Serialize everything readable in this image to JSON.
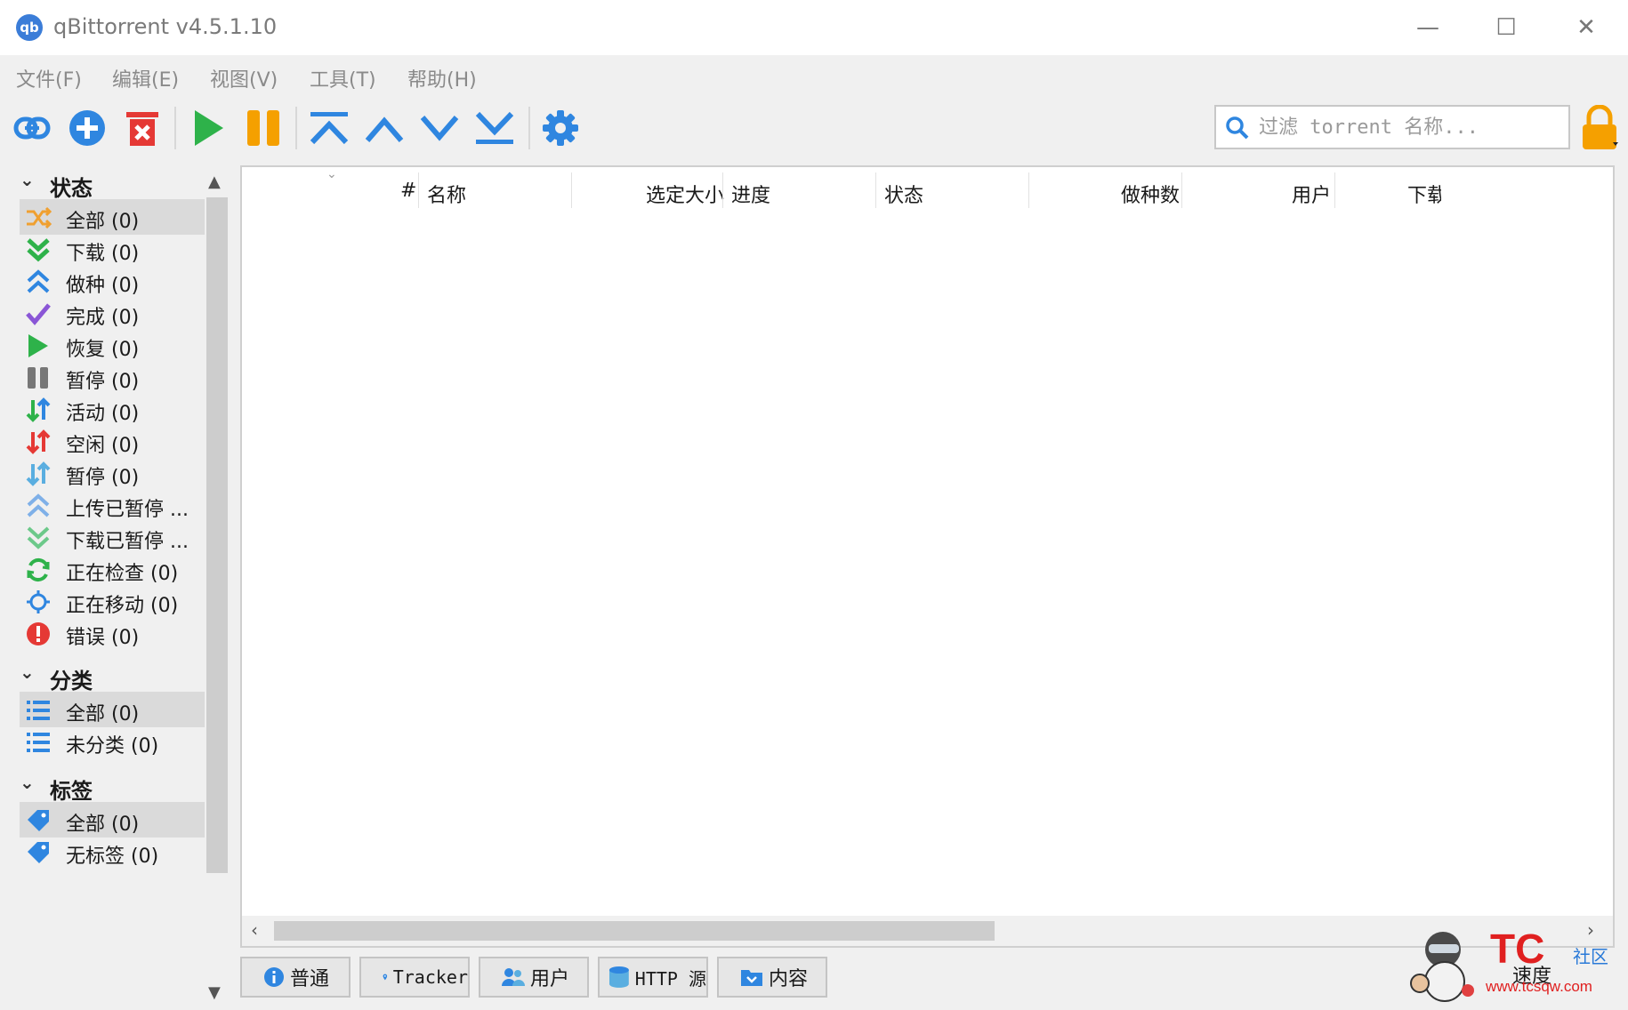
{
  "window": {
    "title": "qBittorrent v4.5.1.10",
    "app_icon_text": "qb",
    "min_symbol": "—",
    "max_symbol": "☐",
    "close_symbol": "✕"
  },
  "menu": {
    "items": [
      "文件(F)",
      "编辑(E)",
      "视图(V)",
      "工具(T)",
      "帮助(H)"
    ]
  },
  "toolbar": {
    "icons": [
      "add-link-icon",
      "add-torrent-icon",
      "delete-icon",
      "resume-icon",
      "pause-icon",
      "move-top-icon",
      "move-up-icon",
      "move-down-icon",
      "move-bottom-icon",
      "settings-icon"
    ],
    "search_placeholder": "过滤 torrent 名称...",
    "accent_blue": "#2f86e0",
    "accent_red": "#e53935",
    "accent_green": "#2eb24a",
    "accent_orange": "#f5a000"
  },
  "sidebar": {
    "status": {
      "title": "状态",
      "items": [
        {
          "label": "全部 (0)",
          "icon": "shuffle-icon",
          "selected": true
        },
        {
          "label": "下载 (0)",
          "icon": "download-icon"
        },
        {
          "label": "做种 (0)",
          "icon": "seeding-icon"
        },
        {
          "label": "完成 (0)",
          "icon": "check-icon"
        },
        {
          "label": "恢复 (0)",
          "icon": "resume-icon"
        },
        {
          "label": "暂停 (0)",
          "icon": "pause-icon"
        },
        {
          "label": "活动 (0)",
          "icon": "active-arrows-icon"
        },
        {
          "label": "空闲 (0)",
          "icon": "inactive-arrows-icon"
        },
        {
          "label": "暂停 (0)",
          "icon": "stalled-arrows-icon"
        },
        {
          "label": "上传已暂停 ...",
          "icon": "upload-paused-icon"
        },
        {
          "label": "下载已暂停 ...",
          "icon": "download-paused-icon"
        },
        {
          "label": "正在检查 (0)",
          "icon": "refresh-icon"
        },
        {
          "label": "正在移动 (0)",
          "icon": "moving-icon"
        },
        {
          "label": "错误 (0)",
          "icon": "error-icon"
        }
      ]
    },
    "categories": {
      "title": "分类",
      "items": [
        {
          "label": "全部 (0)",
          "icon": "list-icon",
          "selected": true
        },
        {
          "label": "未分类 (0)",
          "icon": "list-icon"
        }
      ]
    },
    "tags": {
      "title": "标签",
      "items": [
        {
          "label": "全部 (0)",
          "icon": "tag-icon",
          "selected": true
        },
        {
          "label": "无标签 (0)",
          "icon": "tag-icon"
        }
      ]
    },
    "chevron": "⌄"
  },
  "list": {
    "columns": [
      "#",
      "名称",
      "选定大小",
      "进度",
      "状态",
      "做种数",
      "用户",
      "下载"
    ],
    "rows": []
  },
  "tabs": [
    "普通",
    "Tracker",
    "用户",
    "HTTP 源",
    "内容"
  ],
  "watermark": {
    "brand": "TC",
    "community": "社区",
    "url": "www.tcsqw.com",
    "speed": "速度"
  }
}
